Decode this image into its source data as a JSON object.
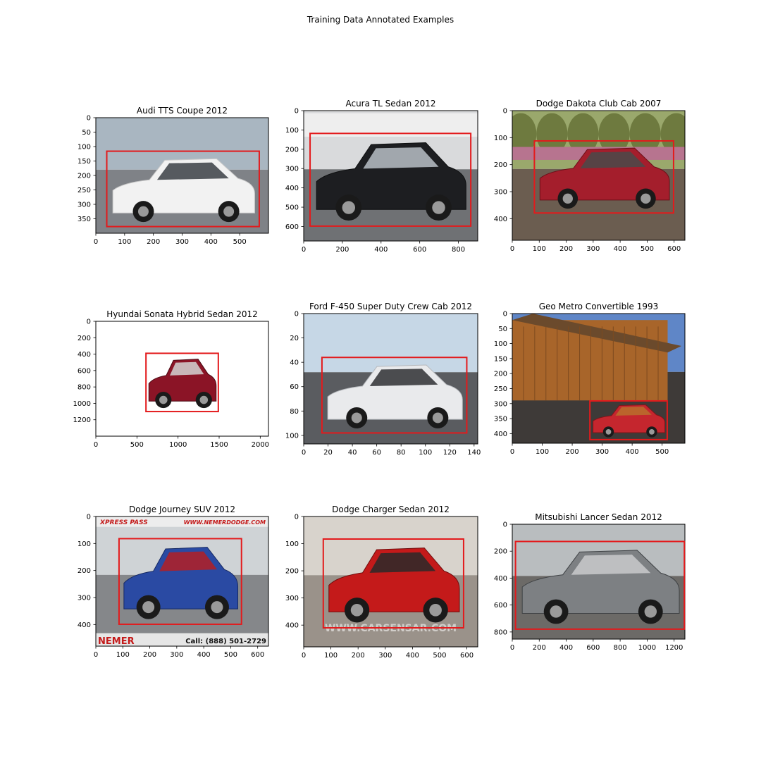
{
  "figure": {
    "title": "Training Data Annotated Examples",
    "box_color": "#e31a1c"
  },
  "panels": [
    {
      "title": "Audi TTS Coupe 2012",
      "image_size": [
        600,
        400
      ],
      "xlim": [
        0,
        600
      ],
      "ylim": [
        400,
        0
      ],
      "xticks": [
        0,
        100,
        200,
        300,
        400,
        500
      ],
      "yticks": [
        0,
        50,
        100,
        150,
        200,
        250,
        300,
        350
      ],
      "bbox_data": [
        38,
        116,
        568,
        377
      ],
      "scene": {
        "sky": "#a9b6c1",
        "ground": "#7f8287",
        "car": "#f2f2f2",
        "car_dark": "#c8c8c8",
        "accent": "#3b3f45"
      }
    },
    {
      "title": "Acura TL Sedan 2012",
      "image_size": [
        900,
        675
      ],
      "xlim": [
        0,
        900
      ],
      "ylim": [
        675,
        0
      ],
      "xticks": [
        0,
        200,
        400,
        600,
        800
      ],
      "yticks": [
        0,
        100,
        200,
        300,
        400,
        500,
        600
      ],
      "bbox_data": [
        33,
        118,
        864,
        598
      ],
      "scene": {
        "sky": "#d9dadc",
        "ground": "#6f7174",
        "car": "#1d1e21",
        "car_dark": "#0e0f10",
        "accent": "#b9c0c6"
      }
    },
    {
      "title": "Dodge Dakota Club Cab 2007",
      "image_size": [
        640,
        480
      ],
      "xlim": [
        0,
        640
      ],
      "ylim": [
        480,
        0
      ],
      "xticks": [
        0,
        100,
        200,
        300,
        400,
        500,
        600
      ],
      "yticks": [
        0,
        100,
        200,
        300,
        400
      ],
      "bbox_data": [
        82,
        112,
        598,
        379
      ],
      "scene": {
        "sky": "#9aa86c",
        "ground": "#6b5d50",
        "car": "#a41e2c",
        "car_dark": "#6c1019",
        "accent": "#4a4a4a"
      }
    },
    {
      "title": "Hyundai Sonata Hybrid Sedan 2012",
      "image_size": [
        2100,
        1400
      ],
      "xlim": [
        0,
        2100
      ],
      "ylim": [
        1400,
        0
      ],
      "xticks": [
        0,
        500,
        1000,
        1500,
        2000
      ],
      "yticks": [
        0,
        200,
        400,
        600,
        800,
        1000,
        1200
      ],
      "bbox_data": [
        610,
        390,
        1490,
        1100
      ],
      "scene": {
        "sky": "#ffffff",
        "ground": "#ffffff",
        "car": "#8b1426",
        "car_dark": "#4a0a14",
        "accent": "#d3d3d3"
      }
    },
    {
      "title": "Ford F-450 Super Duty Crew Cab 2012",
      "image_size": [
        143,
        107
      ],
      "xlim": [
        0,
        143
      ],
      "ylim": [
        107,
        0
      ],
      "xticks": [
        0,
        20,
        40,
        60,
        80,
        100,
        120,
        140
      ],
      "yticks": [
        0,
        20,
        40,
        60,
        80,
        100
      ],
      "bbox_data": [
        15,
        36,
        134,
        98
      ],
      "scene": {
        "sky": "#c6d7e6",
        "ground": "#5a5c60",
        "car": "#e9eaec",
        "car_dark": "#b5b8bc",
        "accent": "#2f3034"
      }
    },
    {
      "title": "Geo Metro Convertible 1993",
      "image_size": [
        576,
        432
      ],
      "xlim": [
        0,
        576
      ],
      "ylim": [
        432,
        0
      ],
      "xticks": [
        0,
        100,
        200,
        300,
        400,
        500
      ],
      "yticks": [
        0,
        50,
        100,
        150,
        200,
        250,
        300,
        350,
        400
      ],
      "bbox_data": [
        259,
        291,
        517,
        420
      ],
      "scene": {
        "sky": "#5f86c7",
        "ground": "#3e3a38",
        "car": "#c5262e",
        "car_dark": "#7e1519",
        "accent": "#b8702c"
      }
    },
    {
      "title": "Dodge Journey SUV 2012",
      "image_size": [
        640,
        480
      ],
      "xlim": [
        0,
        640
      ],
      "ylim": [
        480,
        0
      ],
      "xticks": [
        0,
        100,
        200,
        300,
        400,
        500,
        600
      ],
      "yticks": [
        0,
        100,
        200,
        300,
        400
      ],
      "bbox_data": [
        86,
        82,
        540,
        399
      ],
      "scene": {
        "sky": "#cfd3d6",
        "ground": "#85878a",
        "car": "#2a4aa3",
        "car_dark": "#172a63",
        "accent": "#b31e25"
      },
      "banner_top_left": "XPRESS PASS",
      "banner_top_right": "WWW.NEMERDODGE.COM",
      "banner_bottom_left": "NEMER",
      "banner_bottom_right": "Call: (888) 501-2729"
    },
    {
      "title": "Dodge Charger Sedan 2012",
      "image_size": [
        640,
        480
      ],
      "xlim": [
        0,
        640
      ],
      "ylim": [
        480,
        0
      ],
      "xticks": [
        0,
        100,
        200,
        300,
        400,
        500,
        600
      ],
      "yticks": [
        0,
        100,
        200,
        300,
        400
      ],
      "bbox_data": [
        72,
        83,
        588,
        410
      ],
      "scene": {
        "sky": "#d8d3cc",
        "ground": "#9a928a",
        "car": "#c41a1a",
        "car_dark": "#6f0c0c",
        "accent": "#2a2a2a"
      },
      "watermark": "WWW.CARSENSAR.COM"
    },
    {
      "title": "Mitsubishi Lancer Sedan 2012",
      "image_size": [
        1280,
        853
      ],
      "xlim": [
        0,
        1280
      ],
      "ylim": [
        853,
        0
      ],
      "xticks": [
        0,
        200,
        400,
        600,
        800,
        1000,
        1200
      ],
      "yticks": [
        0,
        200,
        400,
        600,
        800
      ],
      "bbox_data": [
        24,
        128,
        1276,
        779
      ],
      "scene": {
        "sky": "#b9bdbf",
        "ground": "#6c6a67",
        "car": "#7d8083",
        "car_dark": "#3f4245",
        "accent": "#c9cacc"
      }
    }
  ]
}
